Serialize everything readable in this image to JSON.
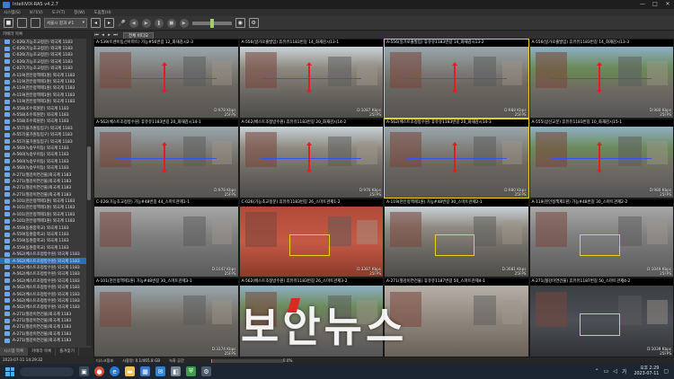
{
  "window": {
    "title": "IntelliVIX-RAS v4.2.7",
    "controls": [
      "—",
      "□",
      "✕"
    ]
  },
  "menu": [
    "시스템(S)",
    "보기(V)",
    "도구(T)",
    "창(W)",
    "도움말(H)"
  ],
  "toolbar": {
    "view_select": "서울시 청과 #1",
    "icons": [
      "camera-icon",
      "layout-1-icon",
      "layout-4-icon",
      "layout-9-icon",
      "layout-16-icon",
      "layout-custom-icon",
      "mic-icon",
      "rewind-icon",
      "play-icon",
      "pause-icon",
      "stop-icon",
      "forward-icon",
      "volume-slider-icon",
      "camera-snapshot-icon",
      "settings-icon"
    ]
  },
  "left_panel": {
    "header": "카메라 목록",
    "cameras": [
      "C-026(가능초교정문) 외국계 1183",
      "C-026(가능초교정문) 외국계 1183",
      "C-026(가능초교정문) 외국계 1183",
      "C-026(가능초교정문) 외국계 1183",
      "C-027(가능초교정문) 외국계 1183",
      "A-119(천안정책제1원) 외국계 1183",
      "A-119(천안정책제1원) 외국계 1183",
      "A-119(천안정책제1원) 외국계 1183",
      "A-119(천안정책제1원) 외국계 1183",
      "A-119(천안정책제1원) 외국계 1183",
      "A-558(조수희원문) 외국계 1183",
      "A-558(조수희원문) 외국계 1183",
      "A-558(조수희원문) 외국계 1183",
      "A-557(울가원동입구) 외국계 1183",
      "A-557(울가원동입구) 외국계 1183",
      "A-557(울가원동입구) 외국계 1183",
      "A-560(녹송우이동) 외국계 1183",
      "A-560(녹송우이동) 외국계 1183",
      "A-560(녹송우이동) 외국계 1183",
      "A-560(녹송우이동) 외국계 1183",
      "A-271(철강이연건물)외국계 1183",
      "A-271(철강이연건물)외국계 1183",
      "A-271(철강이연건물)외국계 1183",
      "A-271(철강이연건물)외국계 1183",
      "A-101(천안정책제1원) 외국계 1183",
      "A-101(천안정책제1원) 외국계 1183",
      "A-101(천안정책제1원) 외국계 1183",
      "A-101(천안정책제1원) 외국계 1183",
      "A-559(동원중학교) 외국계 1183",
      "A-559(동원중학교) 외국계 1183",
      "A-559(동원중학교) 외국계 1183",
      "A-559(동원중학교) 외국계 1183",
      "A-562(베스트조정방수원) 외국계 1183",
      "A-562(베스트조정방수원) 외국계 1183",
      "A-562(베스트조정방수원) 외국계 1183",
      "A-562(베스트조정방수원) 외국계 1183",
      "A-562(베스트조정방수원) 외국계 1183",
      "A-562(베스트조정방수원) 외국계 1183",
      "A-562(베스트조정방수원) 외국계 1183",
      "A-562(베스트조정방수원) 외국계 1183",
      "A-562(베스트조정방수원) 외국계 1183",
      "A-271(철강이연건물)외국계 1183",
      "A-271(철강이연건물)외국계 1183",
      "A-271(철강이연건물)외국계 1183",
      "A-271(철강이연건물)외국계 1183",
      "A-271(철강이연건물)외국계 1183"
    ],
    "selected_index": 33,
    "tabs": [
      "시스템 목록",
      "카메라 목록",
      "즐겨찾기"
    ],
    "bottom_timestamp": "2023-07-11 14:29:32"
  },
  "main": {
    "tab_label": "전체 비디오",
    "tiles": [
      {
        "caption": "A-539(트렌이동선아파트) 가능#56번길 12_화재감시2-3",
        "rate": "D:978 Kbps",
        "fps": "25FPS"
      },
      {
        "caption": "A-556(일가로출발입) 휴유유1183번길 14_화재감시13-1",
        "rate": "D:1087 Kbps",
        "fps": "25FPS"
      },
      {
        "caption": "A-556(일가로출발입) 휴유유1183번길 14_화재감시13-2",
        "rate": "D:988 Kbps",
        "fps": "25FPS"
      },
      {
        "caption": "A-556(일가로출발입) 휴유유1183번길 14_화재감시13-3",
        "rate": "D:980 Kbps",
        "fps": "25FPS"
      },
      {
        "caption": "A-562(베스트조정방수원) 휴유유1183번길 20_화재감시14-1",
        "rate": "D:978 Kbps",
        "fps": "25FPS"
      },
      {
        "caption": "A-562(베스트조정방수원) 휴유유1183번길 20_화재감시14-2",
        "rate": "D:976 Kbps",
        "fps": "25FPS"
      },
      {
        "caption": "A-562(베스트조정방수원) 휴유유1183번길 20_화재감시14-3",
        "rate": "D:980 Kbps",
        "fps": "25FPS"
      },
      {
        "caption": "A-555(삼선교문) 휴유유1183번길 10_화재감시15-1",
        "rate": "D:980 Kbps",
        "fps": "25FPS"
      },
      {
        "caption": "C-026(가능초교정문) 가능#48번길 44_스마트관제1-1",
        "rate": "D:1047 Kbps",
        "fps": "25FPS"
      },
      {
        "caption": "C-026(가능초교정문) 휴유유1183번길 26_스마트관제1-2",
        "rate": "D:3387 Kbps",
        "fps": "25FPS"
      },
      {
        "caption": "A-119(천안정책제1원) 가능#48번길 30_스마트관제2-1",
        "rate": "D:3081 Kbps",
        "fps": "25FPS"
      },
      {
        "caption": "A-119(천안정책제1원) 가능#48번길 30_스마트관제2-2",
        "rate": "D:1049 Kbps",
        "fps": "25FPS"
      },
      {
        "caption": "A-101(천안정책제1원) 가능#48번길 30_스마트관제3-1",
        "rate": "D:3374 Kbps",
        "fps": "25FPS"
      },
      {
        "caption": "A-562(베스트조정방수원) 휴유유1183번길 26_스마트관제3-2",
        "rate": "",
        "fps": ""
      },
      {
        "caption": "A-271(철강이연건물) 휴유유1187번길 50_스마트관제4-1",
        "rate": "",
        "fps": ""
      },
      {
        "caption": "A-271(철강이연건물) 휴유유1187번길 50_스마트관제4-2",
        "rate": "D:1039 Kbps",
        "fps": "25FPS"
      }
    ],
    "status": {
      "left": "디스크정보",
      "usage": "사용량: 0.1/465.8 GB",
      "label": "녹화 공간",
      "percent_text": "0.0%",
      "progress": 0.02
    }
  },
  "taskbar": {
    "icons": [
      "windows-icon",
      "search-icon",
      "task-view-icon",
      "chrome-icon",
      "edge-icon",
      "explorer-icon",
      "store-icon",
      "mail-icon",
      "app-icon",
      "shield-icon",
      "settings-icon"
    ],
    "time": "오후 2:29",
    "date": "2023-07-11"
  },
  "watermark": {
    "text": "보안뉴스"
  },
  "colors": {
    "accent": "#2f6db5",
    "highlight_border": "#e6d21a",
    "arrow": "#e02020",
    "line": "#3355ee"
  }
}
